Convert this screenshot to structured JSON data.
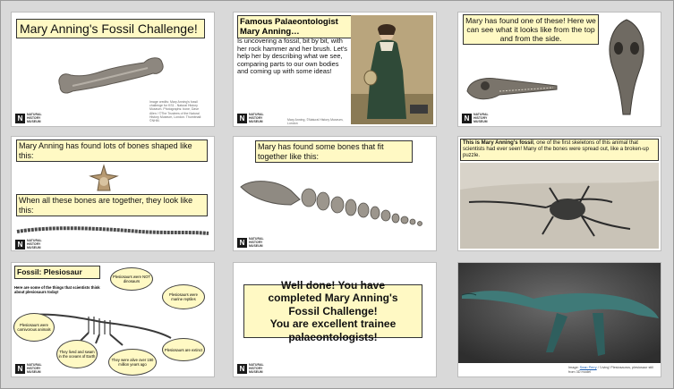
{
  "logo": {
    "mark": "N",
    "text": "NATURAL HISTORY MUSEUM"
  },
  "slides": {
    "s1": {
      "title": "Mary Anning's Fossil Challenge!",
      "small_print": "Image credits: Mary Anning's fossil challenge for KS1 - Natural History Museum. Photographs: bone, Dave Allen / ©The Trustees of the Natural History Museum, London. Thumbnail: ©NHM."
    },
    "s2": {
      "heading": "Famous Palaeontologist Mary Anning…",
      "body": "Is uncovering a fossil, bit by bit, with her rock hammer and her brush. Let's help her by describing what we see, comparing parts to our own bodies and coming up with some ideas!",
      "credit": "Mary Anning, ©Natural History Museum, London"
    },
    "s3": {
      "text": "Mary has found one of these! Here we can see what it looks like from the top and from the side."
    },
    "s4": {
      "top_text": "Mary Anning has found lots of bones shaped like this:",
      "bottom_text": "When all these bones are together, they look like this:"
    },
    "s5": {
      "text": "Mary has found some bones that fit together like this:"
    },
    "s6": {
      "bold": "This is Mary Anning's fossil",
      "rest": ", one of the first skeletons of this animal that scientists had ever seen! Many of the bones were spread out, like a broken-up puzzle."
    },
    "s7": {
      "title": "Fossil: Plesiosaur",
      "intro": "Here are some of the things that scientists think about plesiosaurs today!",
      "bubbles": [
        "Plesiosaurs were NOT dinosaurs",
        "Plesiosaurs were marine reptiles",
        "Plesiosaurs were carnivorous animals",
        "They lived and swam in the oceans of Earth",
        "They were alive over 150 million years ago",
        "Plesiosaurs are extinct"
      ]
    },
    "s8": {
      "lines": [
        "Well done! You have",
        "completed Mary Anning's",
        "Fossil Challenge!",
        "You are excellent trainee",
        "palaeontologists!"
      ]
    },
    "s9": {
      "credit_prefix": "Image: ",
      "credit_link": "Sean Perry",
      "credit_rest": " / 'Living' Plesiosaurus, plesiosaur still from 3D model"
    }
  }
}
